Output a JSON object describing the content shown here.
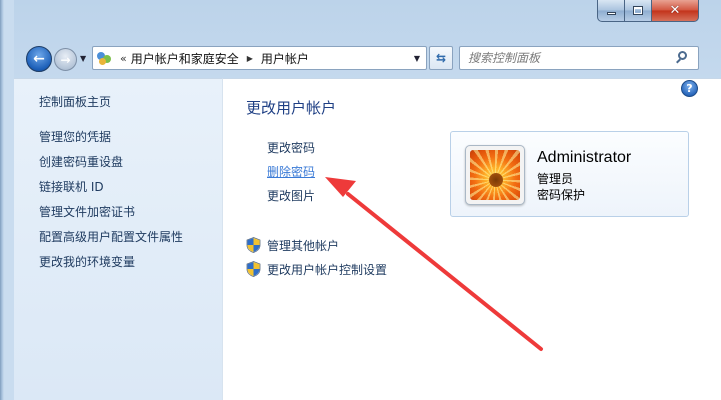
{
  "colors": {
    "title_blue": "#1e3f84",
    "link_dark": "#1e3a5f",
    "link_hover": "#3a7ad6",
    "annotation_red": "#ee3a3a"
  },
  "window": {
    "caption": {
      "minimize_icon": "minimize-icon",
      "maximize_icon": "maximize-icon",
      "close_icon": "close-icon"
    }
  },
  "navigation": {
    "back_icon": "back-arrow-icon",
    "forward_icon": "forward-arrow-icon",
    "address": {
      "chevron": "«",
      "crumbs": [
        "用户帐户和家庭安全",
        "用户帐户"
      ]
    },
    "search_placeholder": "搜索控制面板"
  },
  "sidebar": {
    "home": "控制面板主页",
    "items": [
      "管理您的凭据",
      "创建密码重设盘",
      "链接联机 ID",
      "管理文件加密证书",
      "配置高级用户配置文件属性",
      "更改我的环境变量"
    ]
  },
  "main": {
    "title": "更改用户帐户",
    "tasks": [
      "更改密码",
      "删除密码",
      "更改图片"
    ],
    "admin_tasks": [
      "管理其他帐户",
      "更改用户帐户控制设置"
    ]
  },
  "account": {
    "name": "Administrator",
    "role": "管理员",
    "status": "密码保护"
  }
}
